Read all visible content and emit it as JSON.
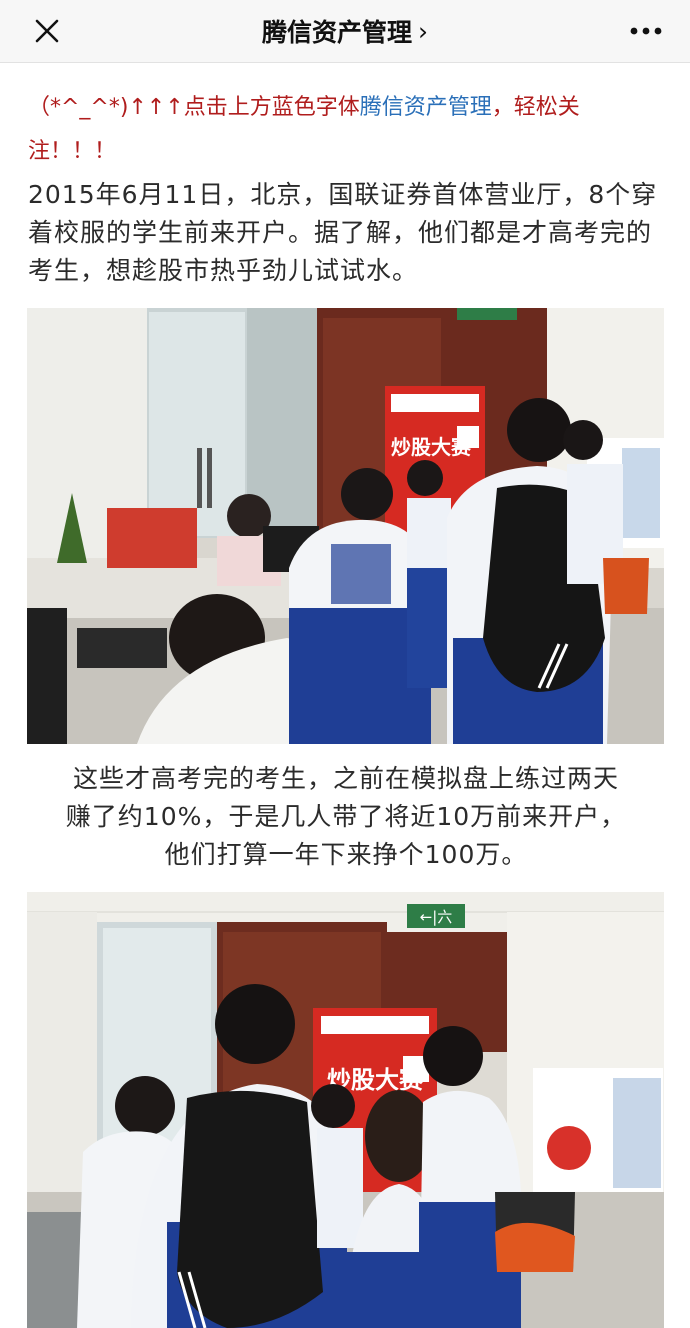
{
  "navbar": {
    "close_icon": "close-icon",
    "title": "腾信资产管理",
    "chevron": "›",
    "more_icon": "more-icon"
  },
  "article": {
    "promo": {
      "prefix": "（*^_^*)↑↑↑点击上方蓝色字体",
      "account_name": "腾信资产管理",
      "suffix": "，轻松关注！！！"
    },
    "paragraph_1": "2015年6月11日，北京，国联证券首体营业厅，8个穿着校服的学生前来开户。据了解，他们都是才高考完的考生，想趁股市热乎劲儿试试水。",
    "photo_1": {
      "banner_text": "炒股大赛"
    },
    "paragraph_2_lines": [
      "这些才高考完的考生，之前在模拟盘上练过两天",
      "赚了约10%，于是几人带了将近10万前来开户，",
      "他们打算一年下来挣个100万。"
    ],
    "photo_2": {
      "banner_text": "炒股大赛",
      "exit_sign": "←|六"
    }
  },
  "colors": {
    "promo_red": "#b01d1d",
    "promo_blue": "#2a6fb8",
    "text": "#2b2b2b",
    "navbar_bg": "#f7f7f7"
  }
}
